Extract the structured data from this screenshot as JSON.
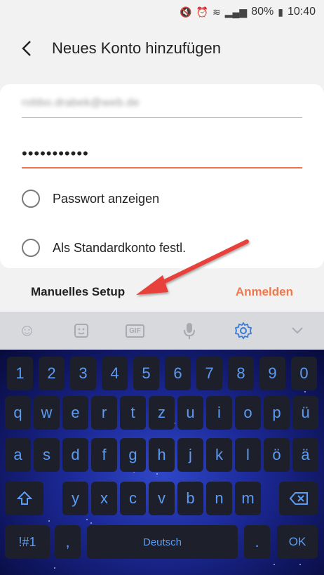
{
  "status": {
    "battery": "80%",
    "time": "10:40"
  },
  "header": {
    "title": "Neues Konto hinzufügen"
  },
  "form": {
    "email_value": "robbo.drabek@web.de",
    "password_value": "•••••••••••",
    "show_password_label": "Passwort anzeigen",
    "default_account_label": "Als Standardkonto festl."
  },
  "actions": {
    "manual_setup": "Manuelles Setup",
    "login": "Anmelden"
  },
  "keyboard": {
    "number_row": [
      "1",
      "2",
      "3",
      "4",
      "5",
      "6",
      "7",
      "8",
      "9",
      "0"
    ],
    "row1": [
      "q",
      "w",
      "e",
      "r",
      "t",
      "z",
      "u",
      "i",
      "o",
      "p",
      "ü"
    ],
    "row2": [
      "a",
      "s",
      "d",
      "f",
      "g",
      "h",
      "j",
      "k",
      "l",
      "ö",
      "ä"
    ],
    "row3": [
      "y",
      "x",
      "c",
      "v",
      "b",
      "n",
      "m"
    ],
    "symbols_key": "!#1",
    "comma_key": ",",
    "space_key": "Deutsch",
    "period_key": ".",
    "ok_key": "OK"
  },
  "colors": {
    "accent": "#f0784c",
    "keyboard_text": "#5b9cf5"
  }
}
